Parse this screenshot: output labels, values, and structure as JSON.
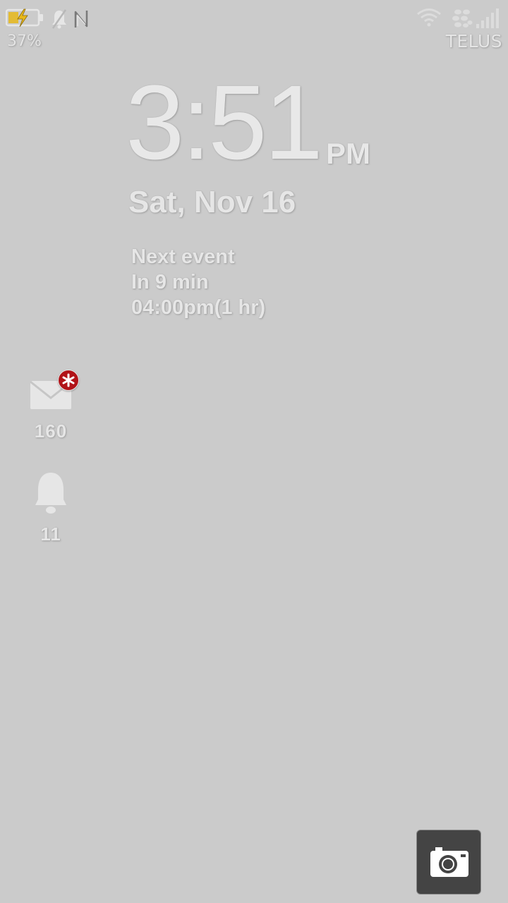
{
  "status_bar": {
    "battery_percent": "37%",
    "battery_level": 0.37,
    "battery_charging": true,
    "carrier": "TELUS",
    "icons": [
      "battery-charging-icon",
      "mute-icon",
      "nfc-icon",
      "wifi-icon",
      "bbm-icon",
      "signal-icon"
    ]
  },
  "clock": {
    "time": "3:51",
    "ampm": "PM",
    "date": "Sat, Nov 16"
  },
  "next_event": {
    "title": "Next event",
    "in": "In 9 min",
    "time": "04:00pm(1 hr)"
  },
  "notifications": [
    {
      "icon": "mail-icon",
      "count": "160",
      "badge_icon": "asterisk-icon"
    },
    {
      "icon": "bell-icon",
      "count": "11"
    }
  ],
  "camera": {
    "icon": "camera-icon"
  },
  "colors": {
    "background": "#cbcbcb",
    "text": "#e6e6e6",
    "badge": "#b11318",
    "camera_button": "#444444",
    "battery_bolt": "#e8b81a"
  }
}
